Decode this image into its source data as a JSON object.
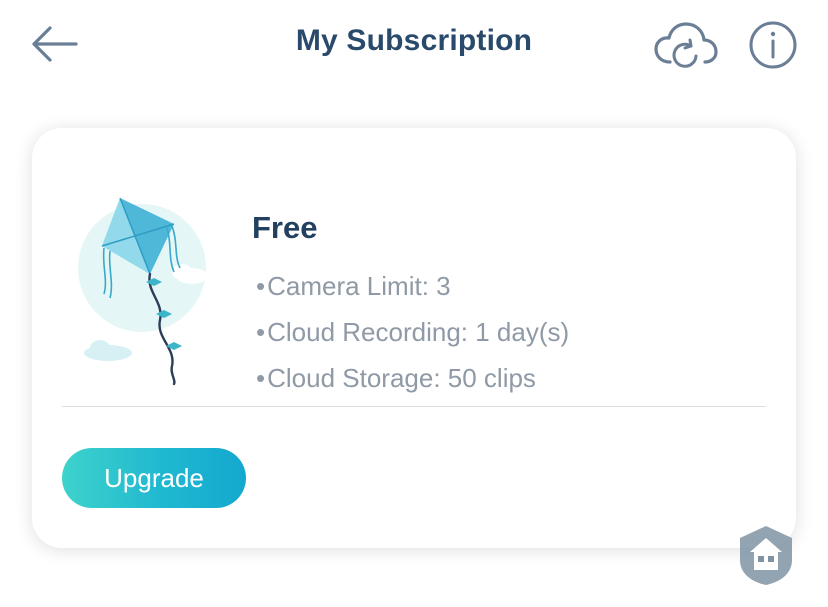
{
  "header": {
    "title": "My Subscription",
    "back_icon": "arrow-left-icon",
    "cloud_icon": "cloud-sync-icon",
    "info_icon": "info-icon"
  },
  "plan": {
    "name": "Free",
    "features": [
      {
        "bullet": "•",
        "text": "Camera Limit: 3"
      },
      {
        "bullet": "•",
        "text": "Cloud Recording: 1 day(s)"
      },
      {
        "bullet": "•",
        "text": "Cloud Storage: 50 clips"
      }
    ],
    "illustration": "kite-icon"
  },
  "actions": {
    "upgrade_label": "Upgrade"
  },
  "colors": {
    "title": "#2a4a6b",
    "icon": "#6a7f95",
    "feature_text": "#8f9aa6",
    "accent_start": "#3ed3cc",
    "accent_end": "#14a8cf"
  }
}
